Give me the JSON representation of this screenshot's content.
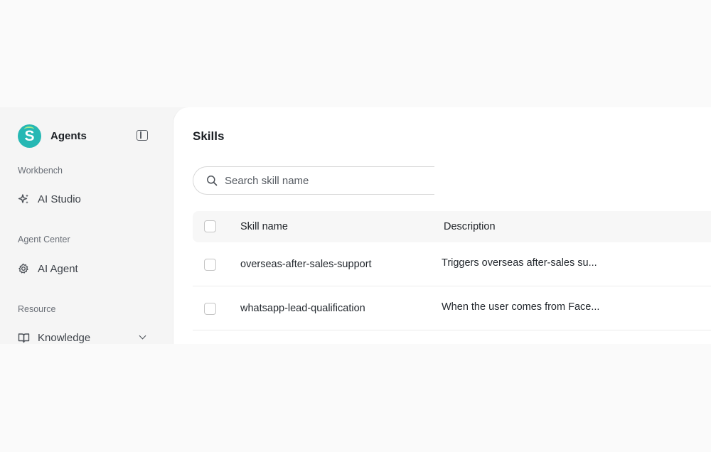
{
  "sidebar": {
    "brand": {
      "logo_letter": "S",
      "title": "Agents"
    },
    "sections": [
      {
        "label": "Workbench",
        "items": [
          {
            "label": "AI Studio",
            "icon": "sparkles-icon"
          }
        ]
      },
      {
        "label": "Agent Center",
        "items": [
          {
            "label": "AI Agent",
            "icon": "gear-icon"
          }
        ]
      },
      {
        "label": "Resource",
        "items": [
          {
            "label": "Knowledge",
            "icon": "book-icon",
            "expandable": true
          }
        ]
      }
    ]
  },
  "main": {
    "title": "Skills",
    "search": {
      "placeholder": "Search skill name",
      "value": ""
    },
    "table": {
      "columns": [
        "Skill name",
        "Description"
      ],
      "rows": [
        {
          "name": "overseas-after-sales-support",
          "description": "Triggers overseas after-sales su..."
        },
        {
          "name": "whatsapp-lead-qualification",
          "description": "When the user comes from Face..."
        }
      ]
    }
  },
  "colors": {
    "brand": "#26b8b4",
    "background": "#fafafa",
    "sidebar_bg": "#f5f5f5",
    "content_bg": "#ffffff"
  }
}
